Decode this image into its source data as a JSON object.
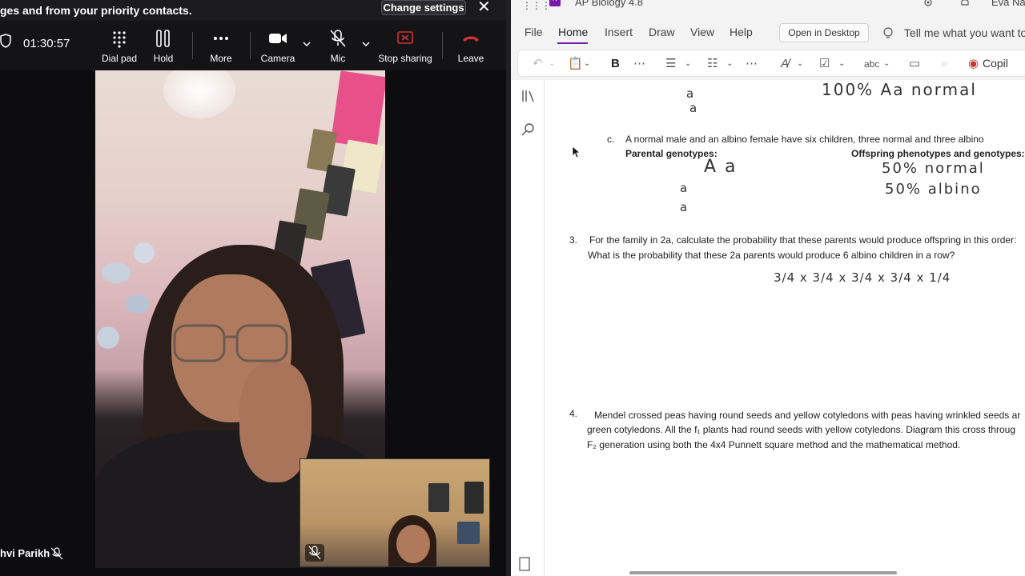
{
  "teams": {
    "notification_text": "ges and from your priority contacts.",
    "change_settings_label": "Change settings",
    "call_timer": "01:30:57",
    "controls": {
      "dial_pad": "Dial pad",
      "hold": "Hold",
      "more": "More",
      "camera": "Camera",
      "mic": "Mic",
      "stop_sharing": "Stop sharing",
      "leave": "Leave"
    },
    "participant_name": "hvi Parikh"
  },
  "onenote": {
    "app_title": "AP Biology 4.8",
    "user_name": "Eva Na",
    "menu": [
      "File",
      "Home",
      "Insert",
      "Draw",
      "View",
      "Help"
    ],
    "open_in_desktop": "Open in Desktop",
    "tell_me_placeholder": "Tell me what you want to",
    "copilot_label": "Copil",
    "content": {
      "top_handwriting_left_line1": "a",
      "top_handwriting_left_line2": "a",
      "top_handwriting_right": "100%  Aa  normal",
      "item_c_label": "c.",
      "item_c_text": "A normal male and an albino female have six children, three normal and three albino",
      "parental_genotypes_label": "Parental genotypes:",
      "offspring_label": "Offspring phenotypes and genotypes:",
      "hw_parent_top": "A  a",
      "hw_parent_left1": "a",
      "hw_parent_left2": "a",
      "hw_offspring_1": "50%  normal",
      "hw_offspring_2": "50%  albino",
      "q3_number": "3.",
      "q3_line1": "For the family in 2a, calculate the probability that these parents would produce offspring in this order:",
      "q3_line2": "What is the probability that these 2a parents would produce 6 albino children in a row?",
      "q3_handwriting": "3/4 x 3/4 x 3/4 x 3/4  x 1/4",
      "q4_number": "4.",
      "q4_line1": "Mendel crossed peas having round seeds and yellow cotyledons with peas having wrinkled seeds ar",
      "q4_line2": "green cotyledons. All the f₁ plants had round seeds with yellow cotyledons. Diagram this cross throug",
      "q4_line3": "F₂ generation using both the 4x4 Punnett square method and the mathematical method."
    }
  },
  "colors": {
    "teams_bg": "#0d0d0f",
    "leave_red": "#d13438",
    "onenote_purple": "#7719aa"
  }
}
